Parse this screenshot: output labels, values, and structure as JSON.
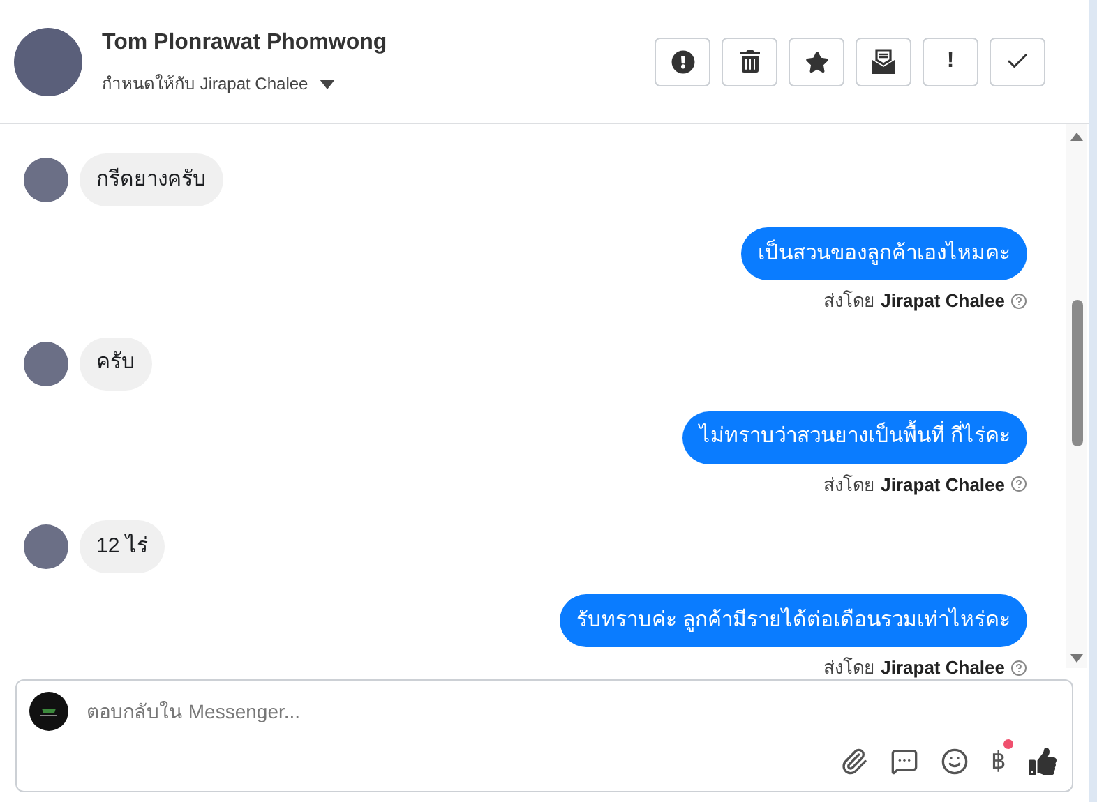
{
  "header": {
    "name": "Tom Plonrawat Phomwong",
    "assigned": "กำหนดให้กับ Jirapat Chalee",
    "actions": [
      {
        "kind": "alert"
      },
      {
        "kind": "trash"
      },
      {
        "kind": "star"
      },
      {
        "kind": "envelope"
      },
      {
        "kind": "text",
        "label": "!"
      },
      {
        "kind": "check"
      }
    ]
  },
  "messages": [
    {
      "kind": "incoming",
      "text": "กรีดยางครับ"
    },
    {
      "kind": "outgoing",
      "text": "เป็นสวนของลูกค้าเองไหมคะ",
      "sender_prefix": "ส่งโดย",
      "sender": "Jirapat Chalee"
    },
    {
      "kind": "incoming",
      "text": "ครับ"
    },
    {
      "kind": "outgoing",
      "text": "ไม่ทราบว่าสวนยางเป็นพื้นที่ กี่ไร่คะ",
      "sender_prefix": "ส่งโดย",
      "sender": "Jirapat Chalee"
    },
    {
      "kind": "incoming",
      "text": "12 ไร่"
    },
    {
      "kind": "outgoing",
      "text": "รับทราบค่ะ ลูกค้ามีรายได้ต่อเดือนรวมเท่าไหร่คะ",
      "sender_prefix": "ส่งโดย",
      "sender": "Jirapat Chalee"
    }
  ],
  "composer": {
    "placeholder": "ตอบกลับใน Messenger...",
    "currency": "฿"
  }
}
